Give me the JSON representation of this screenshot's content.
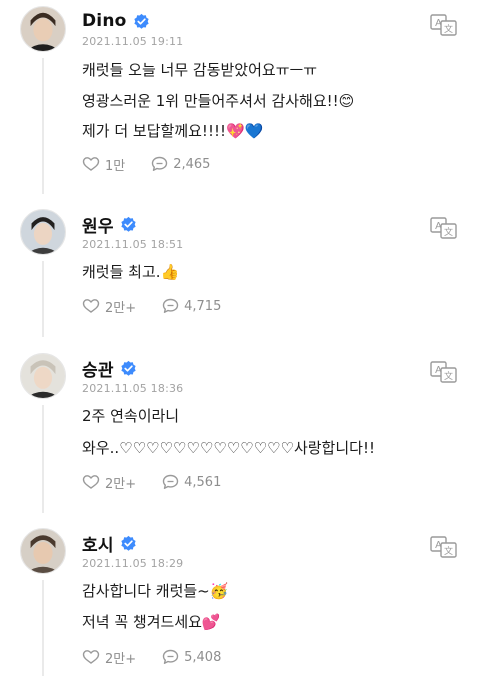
{
  "posts": [
    {
      "author": "Dino",
      "date": "2021.11.05 19:11",
      "lines": [
        "캐럿들 오늘 너무 감동받았어요ㅠㅡㅠ",
        "영광스러운 1위 만들어주셔서 감사해요!!😊",
        "제가 더 보답할께요!!!!💖💙"
      ],
      "likes": "1만",
      "comments": "2,465"
    },
    {
      "author": "원우",
      "date": "2021.11.05 18:51",
      "lines": [
        "캐럿들 최고.👍"
      ],
      "likes": "2만+",
      "comments": "4,715"
    },
    {
      "author": "승관",
      "date": "2021.11.05 18:36",
      "lines": [
        "2주 연속이라니",
        "와우..♡♡♡♡♡♡♡♡♡♡♡♡♡사랑합니다!!"
      ],
      "likes": "2만+",
      "comments": "4,561"
    },
    {
      "author": "호시",
      "date": "2021.11.05 18:29",
      "lines": [
        "감사합니다 캐럿들~🥳",
        "저녁 꼭 챙겨드세요💕"
      ],
      "likes": "2만+",
      "comments": "5,408"
    }
  ],
  "icons": {
    "verified": "verified-badge-icon",
    "translate": "translate-icon",
    "like": "like-icon",
    "comment": "comment-icon"
  },
  "colors": {
    "verified": "#3d8bfd",
    "meta": "#a3a3a3",
    "icon": "#9a9a9a"
  }
}
